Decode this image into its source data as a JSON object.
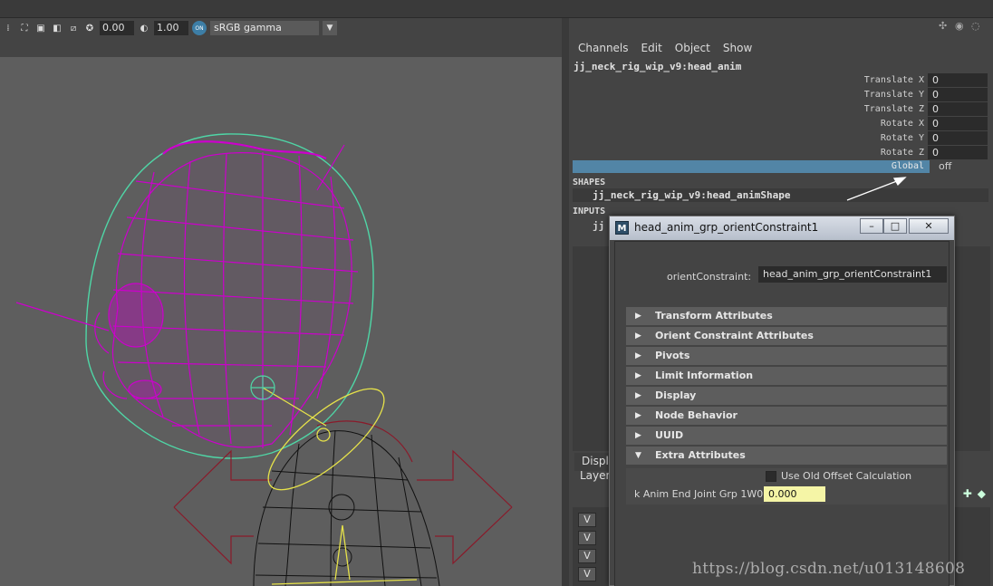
{
  "colors": {
    "viewport_bg": "#5e5e5e",
    "wireframe_head": "#cc00cc",
    "head_control_curve": "#4fd6a6",
    "neck_control_curve": "#e6e24a",
    "body_wireframe": "#000000",
    "arrow_control": "#8a1a2a",
    "global_highlight": "#5285a6",
    "weight_field_bg": "#f5f5a6"
  },
  "viewport_toolbar": {
    "exposure_value": "0.00",
    "gamma_value": "1.00",
    "color_space": "sRGB gamma",
    "icons": [
      "separator-icon",
      "select-camera-icon",
      "image-plane-icon",
      "two-sided-icon",
      "resolution-gate-icon",
      "exposure-icon",
      "gamma-icon",
      "color-management-icon"
    ]
  },
  "channel_box": {
    "menu": [
      "Channels",
      "Edit",
      "Object",
      "Show"
    ],
    "object_name": "jj_neck_rig_wip_v9:head_anim",
    "attributes": [
      {
        "label": "Translate X",
        "value": "0"
      },
      {
        "label": "Translate Y",
        "value": "0"
      },
      {
        "label": "Translate Z",
        "value": "0"
      },
      {
        "label": "Rotate X",
        "value": "0"
      },
      {
        "label": "Rotate Y",
        "value": "0"
      },
      {
        "label": "Rotate Z",
        "value": "0"
      }
    ],
    "global": {
      "label": "Global",
      "value": "off"
    },
    "shapes_header": "SHAPES",
    "shape_name": "jj_neck_rig_wip_v9:head_animShape",
    "inputs_header": "INPUTS",
    "input_partial": "jj"
  },
  "layer_editor": {
    "tab_partial": "Displ",
    "sub_partial": "Layers",
    "visibility_buttons": [
      "V",
      "V",
      "V",
      "V"
    ]
  },
  "dialog": {
    "title": "head_anim_grp_orientConstraint1",
    "title_buttons": {
      "minimize": "–",
      "maximize": "□",
      "close": "✕"
    },
    "node_label": "orientConstraint:",
    "node_value": "head_anim_grp_orientConstraint1",
    "sections": [
      {
        "label": "Transform Attributes",
        "expanded": false
      },
      {
        "label": "Orient Constraint Attributes",
        "expanded": false
      },
      {
        "label": "Pivots",
        "expanded": false
      },
      {
        "label": "Limit Information",
        "expanded": false
      },
      {
        "label": "Display",
        "expanded": false
      },
      {
        "label": "Node Behavior",
        "expanded": false
      },
      {
        "label": "UUID",
        "expanded": false
      },
      {
        "label": "Extra Attributes",
        "expanded": true
      }
    ],
    "extra": {
      "checkbox_label": "Use Old Offset Calculation",
      "checkbox_checked": false,
      "weight_label": "k Anim End Joint Grp 1W0",
      "weight_value": "0.000"
    }
  },
  "watermark": "https://blog.csdn.net/u013148608"
}
